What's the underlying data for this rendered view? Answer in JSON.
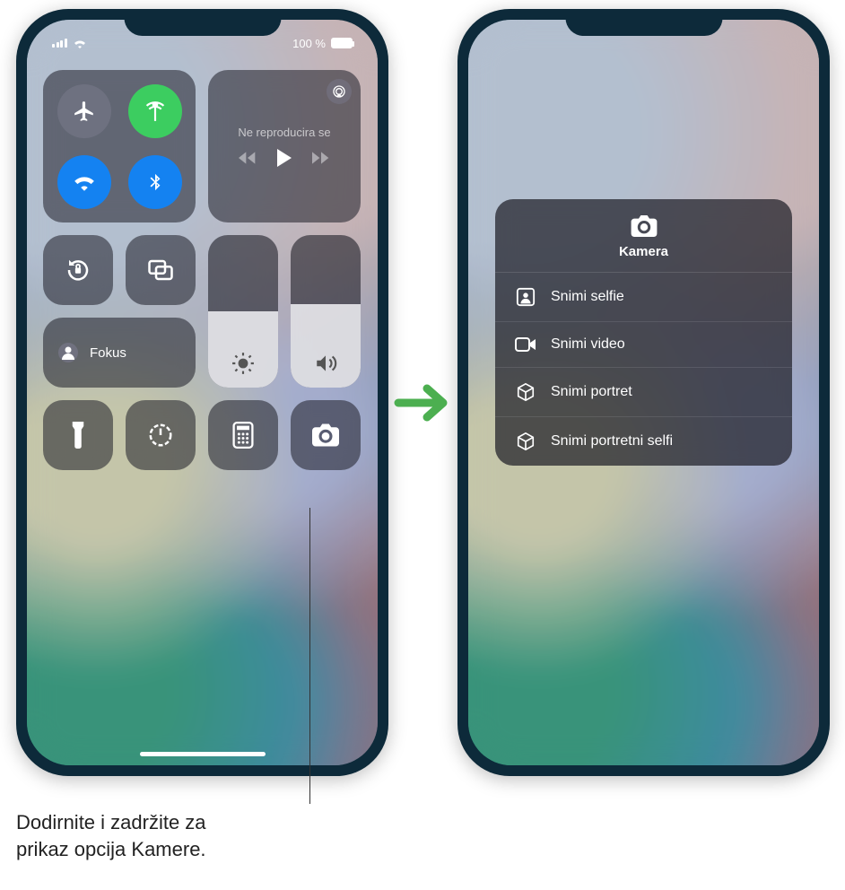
{
  "status": {
    "battery_text": "100 %"
  },
  "connectivity": {
    "airplane_icon": "airplane",
    "cellular_icon": "antenna",
    "wifi_icon": "wifi",
    "bluetooth_icon": "bluetooth"
  },
  "media": {
    "title": "Ne reproducira se",
    "airplay_icon": "airplay"
  },
  "controls": {
    "orientation_lock_icon": "orientation-lock",
    "screen_mirroring_icon": "screen-mirroring",
    "focus_icon": "person-focus",
    "focus_label": "Fokus",
    "brightness_level_pct": 50,
    "volume_level_pct": 55,
    "flashlight_icon": "flashlight",
    "timer_icon": "timer",
    "calculator_icon": "calculator",
    "camera_icon": "camera"
  },
  "camera_menu": {
    "title": "Kamera",
    "header_icon": "camera",
    "items": [
      {
        "icon": "person-square",
        "label": "Snimi selfie"
      },
      {
        "icon": "video",
        "label": "Snimi video"
      },
      {
        "icon": "cube",
        "label": "Snimi portret"
      },
      {
        "icon": "cube",
        "label": "Snimi portretni selfi"
      }
    ]
  },
  "callout": {
    "line1": "Dodirnite i zadržite za",
    "line2": "prikaz opcija Kamere."
  }
}
